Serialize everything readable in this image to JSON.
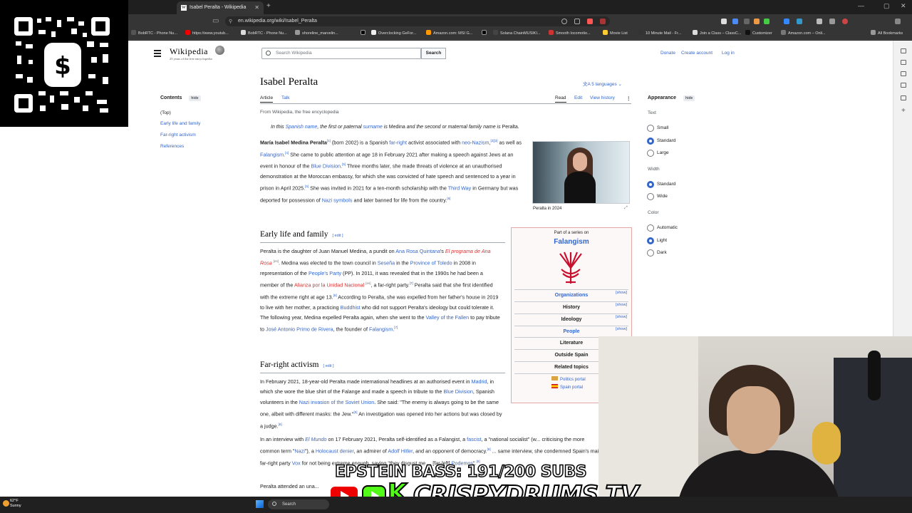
{
  "browser": {
    "tab_title": "Isabel Peralta - Wikipedia",
    "tab_favicon": "W",
    "url": "en.wikipedia.org/wiki/Isabel_Peralta",
    "bookmarks": [
      "BobRTC - Phone Nu...",
      "https://www.youtub...",
      "BobRTC - Phone Nu...",
      "shoreline_marvelin...",
      "",
      "Overclocking GeFor...",
      "Amazon.com: MSI G...",
      "",
      "Solana ChainMUSIKI...",
      "Smooth locomotio...",
      "Movie List",
      "10 Minute Mail - Fr...",
      "Join a Class – ClassC...",
      "Customizer",
      "Amazon.com – Onli...",
      "All Bookmarks"
    ]
  },
  "wiki": {
    "logo": "Wikipedia",
    "logo_sub": "25 years of the free encyclopedia",
    "search_placeholder": "Search Wikipedia",
    "search_button": "Search",
    "donate": "Donate",
    "create_account": "Create account",
    "login": "Log in"
  },
  "toc": {
    "title": "Contents",
    "hide": "hide",
    "items": [
      "(Top)",
      "Early life and family",
      "Far-right activism",
      "References"
    ]
  },
  "article": {
    "title": "Isabel Peralta",
    "languages": "5 languages",
    "tab_article": "Article",
    "tab_talk": "Talk",
    "action_read": "Read",
    "action_edit": "Edit",
    "action_history": "View history",
    "from": "From Wikipedia, the free encyclopedia",
    "hatnote_1": "In this ",
    "hatnote_link1": "Spanish name",
    "hatnote_2": ", the first or paternal ",
    "hatnote_link2": "surname",
    "hatnote_3": " is ",
    "hatnote_4": "Medina",
    "hatnote_5": " and the second or maternal family name is ",
    "hatnote_6": "Peralta",
    "hatnote_7": ".",
    "image_caption": "Peralta in 2024",
    "section_early": "Early life and family",
    "section_far": "Far-right activism",
    "edit": "edit"
  },
  "infobox": {
    "part_of": "Part of a series on",
    "title": "Falangism",
    "rows": [
      {
        "label": "Organizations",
        "show": "[show]"
      },
      {
        "label": "History",
        "show": "[show]"
      },
      {
        "label": "Ideology",
        "show": "[show]"
      },
      {
        "label": "People",
        "show": "[show]"
      },
      {
        "label": "Literature",
        "show": ""
      },
      {
        "label": "Outside Spain",
        "show": ""
      },
      {
        "label": "Related topics",
        "show": ""
      }
    ],
    "portal_1": "Politics portal",
    "portal_2": "Spain portal"
  },
  "appearance": {
    "title": "Appearance",
    "hide": "hide",
    "text_label": "Text",
    "text_options": [
      "Small",
      "Standard",
      "Large"
    ],
    "text_selected": "Standard",
    "width_label": "Width",
    "width_options": [
      "Standard",
      "Wide"
    ],
    "width_selected": "Standard",
    "color_label": "Color",
    "color_options": [
      "Automatic",
      "Light",
      "Dark"
    ],
    "color_selected": "Light"
  },
  "overlay": {
    "line1": "EPSTEIN BASS: 191/200 SUBS",
    "line2": "CRISPYDRUMS TV",
    "kick_letter": "K"
  },
  "taskbar": {
    "temp": "62°F",
    "condition": "Sunny",
    "search": "Search"
  },
  "colors": {
    "link": "#3366cc",
    "red_link": "#d73333",
    "text": "#202122"
  }
}
